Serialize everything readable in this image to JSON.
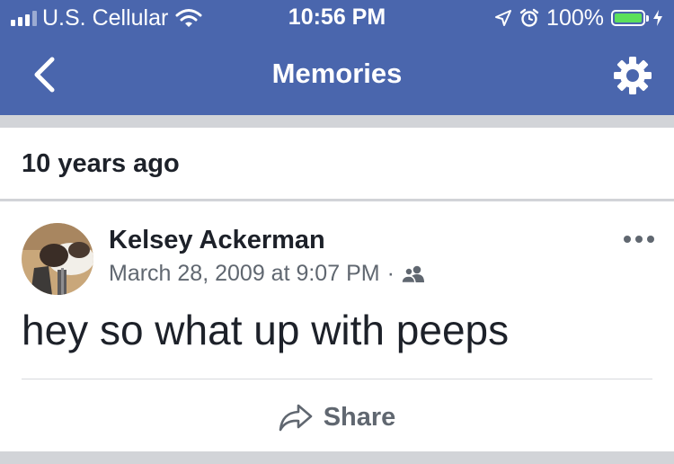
{
  "status_bar": {
    "carrier": "U.S. Cellular",
    "time": "10:56 PM",
    "battery": "100%",
    "battery_fraction": 1.0
  },
  "nav": {
    "title": "Memories",
    "back_icon": "chevron-left-icon",
    "settings_icon": "gear-icon"
  },
  "section": {
    "title": "10 years ago"
  },
  "post": {
    "author": "Kelsey Ackerman",
    "timestamp": "March 28, 2009 at 9:07 PM",
    "separator": "·",
    "privacy_icon": "friends-icon",
    "text": "hey so what up with peeps",
    "share_label": "Share"
  },
  "colors": {
    "header_bg": "#4a66ad",
    "battery_fill": "#5be05b",
    "page_bg": "#d2d4d8",
    "secondary_text": "#606770"
  }
}
